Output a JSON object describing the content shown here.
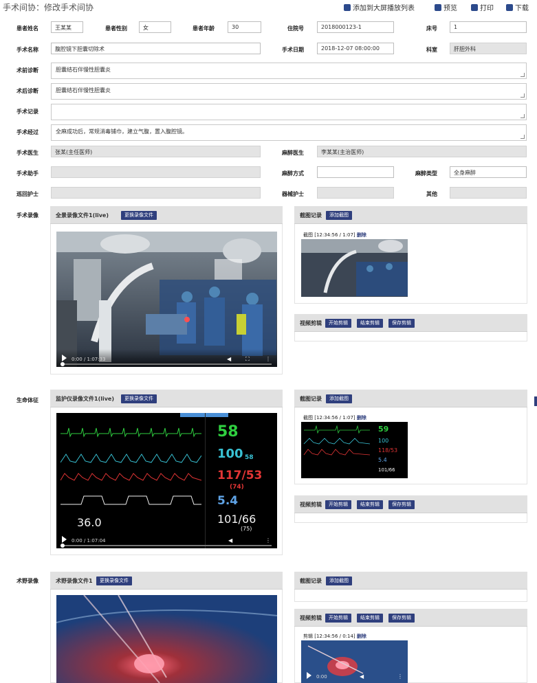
{
  "header": {
    "title": "手术间协：修改手术间协",
    "actions": [
      {
        "label": "添加到大屏播放列表",
        "icon": "monitor-icon"
      },
      {
        "label": "预览",
        "icon": "preview-icon"
      },
      {
        "label": "打印",
        "icon": "print-icon"
      },
      {
        "label": "下载",
        "icon": "download-icon"
      }
    ]
  },
  "form": {
    "row1": {
      "patient_name_label": "患者姓名",
      "patient_name": "王某某",
      "gender_label": "患者性别",
      "gender": "女",
      "age_label": "患者年龄",
      "age": "30",
      "case_no_label": "住院号",
      "case_no": "2018000123-1",
      "bed_label": "床号",
      "bed": "1"
    },
    "row2": {
      "surgery_name_label": "手术名称",
      "surgery_name": "腹腔镜下胆囊切除术",
      "surgery_date_label": "手术日期",
      "surgery_date": "2018-12-07 08:00:00",
      "dept_label": "科室",
      "dept": "肝胆外科"
    },
    "preop_label": "术前诊断",
    "preop": "胆囊结石伴慢性胆囊炎",
    "postop_label": "术后诊断",
    "postop": "胆囊结石伴慢性胆囊炎",
    "proc_label": "手术记录",
    "proc": "",
    "detail_label": "手术经过",
    "detail": "全麻成功后，常规消毒铺巾，建立气腹，置入腹腔镜。",
    "row3": {
      "surgeon_label": "手术医生",
      "surgeon": "张某(主任医师)",
      "anes_label": "麻醉医生",
      "anes": "李某某(主治医师)"
    },
    "row4": {
      "assistant_label": "手术助手",
      "assistant": "",
      "anes_method_label": "麻醉方式",
      "anes_method": "",
      "anes_type_label": "麻醉类型",
      "anes_type": "全身麻醉"
    },
    "row5": {
      "nurse_label": "巡回护士",
      "nurse": "",
      "scrub_label": "器械护士",
      "scrub": "",
      "other_label": "其他",
      "other": ""
    }
  },
  "sections": [
    {
      "label": "手术录像",
      "video_panel_label": "全景录像文件1(live)",
      "video_button": "更换录像文件",
      "video_time": "0:00 / 1:07:33",
      "shot_panel_label": "截图记录",
      "shot_button": "添加截图",
      "thumb_caption_prefix": "截图",
      "thumb_caption_time": "[12:34:56 / 1:07]",
      "thumb_caption_action": "删除",
      "clip_panel_label": "视频剪辑",
      "clip_buttons": [
        "开始剪辑",
        "结束剪辑",
        "保存剪辑"
      ]
    },
    {
      "label": "生命体征",
      "video_panel_label": "监护仪录像文件1(live)",
      "video_button": "更换录像文件",
      "video_time": "0:00 / 1:07:04",
      "shot_panel_label": "截图记录",
      "shot_button": "添加截图",
      "thumb_caption_prefix": "截图",
      "thumb_caption_time": "[12:34:56 / 1:07]",
      "thumb_caption_action": "删除",
      "clip_panel_label": "视频剪辑",
      "clip_buttons": [
        "开始剪辑",
        "结束剪辑",
        "保存剪辑"
      ],
      "monitor": {
        "hr": "58",
        "spo2": "100",
        "spo2_small": "58",
        "nibp": "117/53",
        "nibp_mean": "(74)",
        "etco2": "5.4",
        "temp": "36.0",
        "abp": "101/66",
        "abp_mean": "(75)"
      }
    },
    {
      "label": "术野录像",
      "video_panel_label": "术野录像文件1",
      "video_button": "更换录像文件",
      "shot_panel_label": "截图记录",
      "shot_button": "添加截图",
      "clip_panel_label": "视频剪辑",
      "clip_buttons": [
        "开始剪辑",
        "结束剪辑",
        "保存剪辑"
      ],
      "thumb_caption_prefix": "剪辑",
      "thumb_caption_time": "[12:34:56 / 0:14]",
      "thumb_caption_action": "删除",
      "thumb_time": "0:00"
    }
  ],
  "colors": {
    "accent": "#2f3f7d",
    "panel": "#e1e1e1",
    "field_gray": "#e4e4e4"
  }
}
